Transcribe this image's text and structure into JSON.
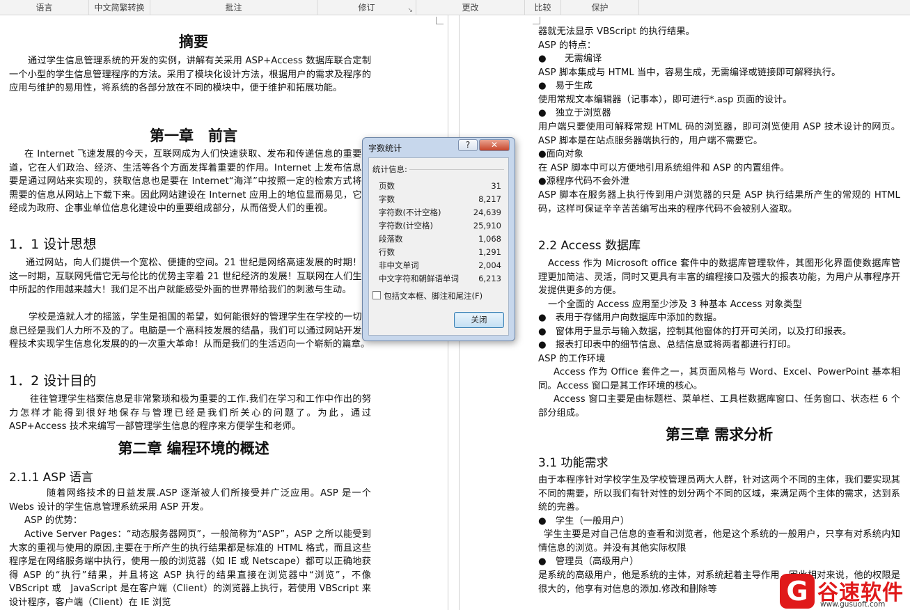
{
  "ribbon": {
    "groups": [
      "语言",
      "中文简繁转换",
      "批注",
      "修订",
      "更改",
      "比较",
      "保护"
    ]
  },
  "left_page": {
    "abstract_title": "摘要",
    "abstract": "通过学生信息管理系统的开发的实例，讲解有关采用 ASP+Access 数据库联合定制一个小型的学生信息管理程序的方法。采用了模块化设计方法，根据用户的需求及程序的应用与维护的易用性，将系统的各部分放在不同的模块中，便于维护和拓展功能。",
    "ch1_title": "第一章　前言",
    "ch1_p1": "在 Internet 飞速发展的今天，互联网成为人们快速获取、发布和传递信息的重要渠道，它在人们政治、经济、生活等各个方面发挥着重要的作用。Internet 上发布信息主要是通过网站来实现的，获取信息也是要在 Internet“海洋”中按照一定的检索方式将所需要的信息从网站上下载下来。因此网站建设在 Internet 应用上的地位显而易见，它已经成为政府、企事业单位信息化建设中的重要组成部分，从而倍受人们的重视。",
    "s11_title": "1．1 设计思想",
    "s11_p1": "通过网站，向人们提供一个宽松、便捷的空间。21 世纪是网络高速发展的时期！在这一时期，互联网凭借它无与伦比的优势主宰着 21 世纪经济的发展！互联网在人们生活中所起的作用越来越大！我们足不出户就能感受外面的世界带给我们的刺激与生动。",
    "s11_p2": "学校是造就人才的摇篮，学生是祖国的希望，如何能很好的管理学生在学校的一切信息已经是我们人力所不及的了。电脑是一个高科技发展的结晶，我们可以通过网站开发编程技术实现学生信息化发展的的一次重大革命！从而是我们的生活迈向一个崭新的篇章。",
    "s12_title": "1．2 设计目的",
    "s12_p1": "往往管理学生档案信息是非常繁琐和极为重要的工作.我们在学习和工作中作出的努力怎样才能得到很好地保存与管理已经是我们所关心的问题了。为此，通过 ASP+Access 技术来编写一部管理学生信息的程序来方便学生和老师。",
    "ch2_title": "第二章 编程环境的概述",
    "s211_title": "2.1.1 ASP 语言",
    "s211_p1": "随着网络技术的日益发展.ASP 逐渐被人们所接受并广泛应用。ASP 是一个 Webs 设计的学生信息管理系统采用 ASP 开发。",
    "asp_adv": "ASP 的优势：",
    "s211_p2": "Active Server Pages：“动态服务器网页”，一般简称为“ASP”，ASP 之所以能受到大家的重视与使用的原因,主要在于所产生的执行结果都是标准的 HTML 格式，而且这些程序是在网络服务端中执行，使用一般的浏览器（如 IE 或 Netscape）都可以正确地获得 ASP 的“执行”结果，并且将这 ASP 执行的结果直接在浏览器中“浏览”，不像 VBScript 或　JavaScript 是在客户端（Client）的浏览器上执行，若使用 VBScript 来设计程序，客户端（Client）在 IE 浏览"
  },
  "right_page": {
    "r_p0": "器就无法显示 VBScript 的执行结果。",
    "asp_feat": "ASP 的特点：",
    "b1": "●　　无需编译",
    "b1_t": "ASP 脚本集成与 HTML 当中，容易生成，无需编译或链接即可解释执行。",
    "b2": "●　易于生成",
    "b2_t": "使用常规文本编辑器（记事本），即可进行*.asp 页面的设计。",
    "b3": "●　独立于浏览器",
    "b3_t": "用户端只要使用可解释常规 HTML 码的浏览器，即可浏览使用 ASP 技术设计的网页。ASP 脚本是在站点服务器端执行的，用户端不需要它。",
    "b4": "●面向对象",
    "b4_t": "在 ASP 脚本中可以方便地引用系统组件和 ASP 的内置组件。",
    "b5": "●源程序代码不会外泄",
    "b5_t": "ASP 脚本在服务器上执行传到用户浏览器的只是 ASP 执行结果所产生的常规的 HTML 码，这样可保证辛辛苦苦编写出来的程序代码不会被别人盗取。",
    "s22_title": "2.2 Access 数据库",
    "s22_p1": "Access 作为 Microsoft office 套件中的数据库管理软件，其图形化界面使数据库管理更加简洁、灵活，同时又更具有丰富的编程接口及强大的报表功能，为用户从事程序开发提供更多的方便。",
    "s22_p2": "一个全面的 Access 应用至少涉及 3 种基本 Access 对象类型",
    "s22_b1": "●　表用于存储用户向数据库中添加的数据。",
    "s22_b2": "●　窗体用于显示与输入数据，控制其他窗体的打开可关闭，以及打印报表。",
    "s22_b3": "●　报表打印表中的细节信息、总结信息或将两者都进行打印。",
    "s22_env": "ASP 的工作环境",
    "s22_p3": "Access 作为 Office 套件之一，其页面风格与 Word、Excel、PowerPoint 基本相同。Access 窗口是其工作环境的核心。",
    "s22_p4": "Access 窗口主要是由标题栏、菜单栏、工具栏数据库窗口、任务窗口、状态栏 6 个部分组成。",
    "ch3_title": "第三章 需求分析",
    "s31_title": "3.1 功能需求",
    "s31_p1": "由于本程序针对学校学生及学校管理员两大人群，针对这两个不同的主体，我们要实现其不同的需要，所以我们有针对性的划分两个不同的区域，来满足两个主体的需求，达到系统的完善。",
    "s31_b1": "●　学生（一般用户）",
    "s31_b1_t": "学生主要是对自己信息的查看和浏览者，他是这个系统的一般用户，只享有对系统内知情信息的浏览。并没有其他实际权限",
    "s31_b2": "●　管理员（高级用户）",
    "s31_b2_t": "是系统的高级用户，他是系统的主体，对系统起着主导作用，因此相对来说，他的权限是很大的，他享有对信息的添加.修改和删除等"
  },
  "dialog": {
    "title": "字数统计",
    "help": "?",
    "close_x": "✕",
    "stats_label": "统计信息:",
    "stats": [
      {
        "label": "页数",
        "value": "31"
      },
      {
        "label": "字数",
        "value": "8,217"
      },
      {
        "label": "字符数(不计空格)",
        "value": "24,639"
      },
      {
        "label": "字符数(计空格)",
        "value": "25,910"
      },
      {
        "label": "段落数",
        "value": "1,068"
      },
      {
        "label": "行数",
        "value": "1,291"
      },
      {
        "label": "非中文单词",
        "value": "2,004"
      },
      {
        "label": "中文字符和朝鲜语单词",
        "value": "6,213"
      }
    ],
    "checkbox_label": "包括文本框、脚注和尾注(F)",
    "close_button": "关闭"
  },
  "watermark": {
    "logo_letter": "G",
    "brand": "谷速软件",
    "url": "www.gusuoft.com"
  }
}
